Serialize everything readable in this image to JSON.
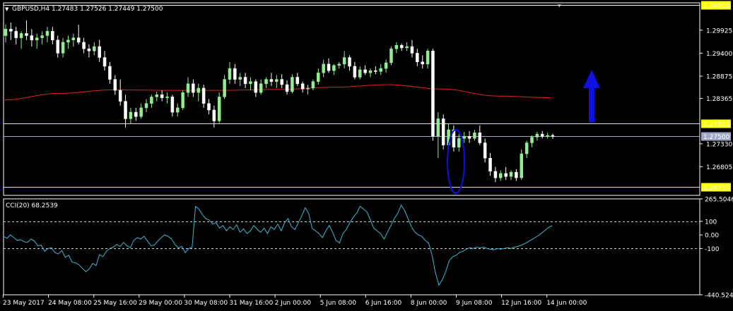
{
  "header": {
    "title": "GBPUSD,H4  1.27483 1.27526 1.27449 1.27500"
  },
  "indicator": {
    "label": "CCI(20) 68.2539"
  },
  "colors": {
    "background": "#000000",
    "frame": "#ffffff",
    "bull": "#90ee90",
    "bear": "#ffffff",
    "ma": "#e02020",
    "level": "#ffff00",
    "bid": "#a0a8c8",
    "cci": "#40b8d0",
    "annotation": "#1010e0"
  },
  "chart_data": [
    {
      "type": "candlestick",
      "symbol": "GBPUSD",
      "timeframe": "H4",
      "ylim": [
        1.2615,
        1.3055
      ],
      "y_ticks": [
        "1.30500",
        "1.29925",
        "1.29400",
        "1.28875",
        "1.28365",
        "1.27800",
        "1.27500",
        "1.27330",
        "1.26805",
        "1.26350"
      ],
      "x_ticks": [
        "23 May 2017",
        "24 May 08:00",
        "25 May 16:00",
        "29 May 00:00",
        "30 May 08:00",
        "31 May 16:00",
        "2 Jun 00:00",
        "5 Jun 08:00",
        "6 Jun 16:00",
        "8 Jun 00:00",
        "9 Jun 08:00",
        "12 Jun 16:00",
        "14 Jun 00:00"
      ],
      "levels": [
        {
          "value": 1.305,
          "label": "1.30500",
          "color": "#ffffff"
        },
        {
          "value": 1.278,
          "label": "1.27800",
          "color": "#ffff00"
        },
        {
          "value": 1.275,
          "label": "1.27500",
          "color": "#a0a8c8"
        },
        {
          "value": 1.2635,
          "label": "1.26350",
          "color": "#ffff00"
        }
      ],
      "ma_anchor": [
        1.2833,
        1.2848,
        1.2856,
        1.2855,
        1.2855,
        1.2857,
        1.2862,
        1.2868,
        1.2858,
        1.2842,
        1.2838
      ],
      "candles": [
        {
          "o": 1.298,
          "h": 1.3005,
          "l": 1.2965,
          "c": 1.2995
        },
        {
          "o": 1.2995,
          "h": 1.301,
          "l": 1.297,
          "c": 1.299
        },
        {
          "o": 1.299,
          "h": 1.3,
          "l": 1.296,
          "c": 1.2975
        },
        {
          "o": 1.2975,
          "h": 1.299,
          "l": 1.295,
          "c": 1.2985
        },
        {
          "o": 1.2985,
          "h": 1.3015,
          "l": 1.297,
          "c": 1.298
        },
        {
          "o": 1.298,
          "h": 1.2995,
          "l": 1.2955,
          "c": 1.297
        },
        {
          "o": 1.297,
          "h": 1.2985,
          "l": 1.295,
          "c": 1.2975
        },
        {
          "o": 1.2975,
          "h": 1.299,
          "l": 1.296,
          "c": 1.298
        },
        {
          "o": 1.298,
          "h": 1.3,
          "l": 1.2965,
          "c": 1.299
        },
        {
          "o": 1.299,
          "h": 1.3,
          "l": 1.296,
          "c": 1.297
        },
        {
          "o": 1.297,
          "h": 1.298,
          "l": 1.293,
          "c": 1.294
        },
        {
          "o": 1.294,
          "h": 1.2975,
          "l": 1.293,
          "c": 1.2965
        },
        {
          "o": 1.2965,
          "h": 1.298,
          "l": 1.295,
          "c": 1.297
        },
        {
          "o": 1.297,
          "h": 1.2985,
          "l": 1.2955,
          "c": 1.2975
        },
        {
          "o": 1.2975,
          "h": 1.3005,
          "l": 1.296,
          "c": 1.2965
        },
        {
          "o": 1.2965,
          "h": 1.2975,
          "l": 1.294,
          "c": 1.295
        },
        {
          "o": 1.295,
          "h": 1.296,
          "l": 1.293,
          "c": 1.2945
        },
        {
          "o": 1.2945,
          "h": 1.2965,
          "l": 1.2935,
          "c": 1.2955
        },
        {
          "o": 1.2955,
          "h": 1.297,
          "l": 1.292,
          "c": 1.293
        },
        {
          "o": 1.293,
          "h": 1.2945,
          "l": 1.29,
          "c": 1.291
        },
        {
          "o": 1.291,
          "h": 1.292,
          "l": 1.287,
          "c": 1.288
        },
        {
          "o": 1.288,
          "h": 1.289,
          "l": 1.2845,
          "c": 1.2855
        },
        {
          "o": 1.2855,
          "h": 1.288,
          "l": 1.282,
          "c": 1.283
        },
        {
          "o": 1.283,
          "h": 1.2845,
          "l": 1.277,
          "c": 1.279
        },
        {
          "o": 1.279,
          "h": 1.2815,
          "l": 1.2778,
          "c": 1.2805
        },
        {
          "o": 1.2805,
          "h": 1.2815,
          "l": 1.2785,
          "c": 1.2795
        },
        {
          "o": 1.2795,
          "h": 1.2825,
          "l": 1.279,
          "c": 1.2815
        },
        {
          "o": 1.2815,
          "h": 1.2835,
          "l": 1.2805,
          "c": 1.2825
        },
        {
          "o": 1.2825,
          "h": 1.2845,
          "l": 1.2815,
          "c": 1.284
        },
        {
          "o": 1.284,
          "h": 1.2852,
          "l": 1.283,
          "c": 1.2845
        },
        {
          "o": 1.2845,
          "h": 1.2855,
          "l": 1.283,
          "c": 1.2838
        },
        {
          "o": 1.2838,
          "h": 1.285,
          "l": 1.2825,
          "c": 1.284
        },
        {
          "o": 1.284,
          "h": 1.2845,
          "l": 1.2795,
          "c": 1.2805
        },
        {
          "o": 1.2805,
          "h": 1.2825,
          "l": 1.2795,
          "c": 1.2815
        },
        {
          "o": 1.2815,
          "h": 1.2855,
          "l": 1.281,
          "c": 1.285
        },
        {
          "o": 1.285,
          "h": 1.2885,
          "l": 1.284,
          "c": 1.287
        },
        {
          "o": 1.287,
          "h": 1.288,
          "l": 1.284,
          "c": 1.285
        },
        {
          "o": 1.285,
          "h": 1.287,
          "l": 1.283,
          "c": 1.286
        },
        {
          "o": 1.286,
          "h": 1.2868,
          "l": 1.2815,
          "c": 1.2825
        },
        {
          "o": 1.2825,
          "h": 1.2835,
          "l": 1.28,
          "c": 1.281
        },
        {
          "o": 1.281,
          "h": 1.282,
          "l": 1.277,
          "c": 1.2785
        },
        {
          "o": 1.2785,
          "h": 1.285,
          "l": 1.278,
          "c": 1.284
        },
        {
          "o": 1.284,
          "h": 1.289,
          "l": 1.2835,
          "c": 1.288
        },
        {
          "o": 1.288,
          "h": 1.292,
          "l": 1.287,
          "c": 1.2905
        },
        {
          "o": 1.2905,
          "h": 1.2915,
          "l": 1.287,
          "c": 1.288
        },
        {
          "o": 1.288,
          "h": 1.2895,
          "l": 1.2865,
          "c": 1.2885
        },
        {
          "o": 1.2885,
          "h": 1.2895,
          "l": 1.286,
          "c": 1.287
        },
        {
          "o": 1.287,
          "h": 1.2885,
          "l": 1.2855,
          "c": 1.2875
        },
        {
          "o": 1.2875,
          "h": 1.288,
          "l": 1.284,
          "c": 1.285
        },
        {
          "o": 1.285,
          "h": 1.288,
          "l": 1.2845,
          "c": 1.287
        },
        {
          "o": 1.287,
          "h": 1.2885,
          "l": 1.286,
          "c": 1.288
        },
        {
          "o": 1.288,
          "h": 1.2895,
          "l": 1.2865,
          "c": 1.2875
        },
        {
          "o": 1.2875,
          "h": 1.289,
          "l": 1.286,
          "c": 1.288
        },
        {
          "o": 1.288,
          "h": 1.2892,
          "l": 1.286,
          "c": 1.2868
        },
        {
          "o": 1.2868,
          "h": 1.2878,
          "l": 1.2845,
          "c": 1.2852
        },
        {
          "o": 1.2852,
          "h": 1.2892,
          "l": 1.2848,
          "c": 1.2885
        },
        {
          "o": 1.2885,
          "h": 1.2895,
          "l": 1.2865,
          "c": 1.287
        },
        {
          "o": 1.287,
          "h": 1.2875,
          "l": 1.285,
          "c": 1.2858
        },
        {
          "o": 1.2858,
          "h": 1.2868,
          "l": 1.2845,
          "c": 1.286
        },
        {
          "o": 1.286,
          "h": 1.288,
          "l": 1.2855,
          "c": 1.2875
        },
        {
          "o": 1.2875,
          "h": 1.2905,
          "l": 1.2868,
          "c": 1.2895
        },
        {
          "o": 1.2895,
          "h": 1.2925,
          "l": 1.2885,
          "c": 1.2915
        },
        {
          "o": 1.2915,
          "h": 1.2928,
          "l": 1.2895,
          "c": 1.29
        },
        {
          "o": 1.29,
          "h": 1.2915,
          "l": 1.289,
          "c": 1.2912
        },
        {
          "o": 1.2912,
          "h": 1.292,
          "l": 1.2905,
          "c": 1.2915
        },
        {
          "o": 1.2915,
          "h": 1.2945,
          "l": 1.2905,
          "c": 1.293
        },
        {
          "o": 1.293,
          "h": 1.2935,
          "l": 1.29,
          "c": 1.291
        },
        {
          "o": 1.291,
          "h": 1.292,
          "l": 1.288,
          "c": 1.2885
        },
        {
          "o": 1.2885,
          "h": 1.291,
          "l": 1.288,
          "c": 1.2902
        },
        {
          "o": 1.2902,
          "h": 1.2912,
          "l": 1.289,
          "c": 1.2895
        },
        {
          "o": 1.2895,
          "h": 1.2905,
          "l": 1.2885,
          "c": 1.29
        },
        {
          "o": 1.29,
          "h": 1.291,
          "l": 1.2892,
          "c": 1.2898
        },
        {
          "o": 1.2898,
          "h": 1.2915,
          "l": 1.289,
          "c": 1.2905
        },
        {
          "o": 1.2905,
          "h": 1.2925,
          "l": 1.2895,
          "c": 1.2918
        },
        {
          "o": 1.2918,
          "h": 1.2955,
          "l": 1.2912,
          "c": 1.295
        },
        {
          "o": 1.295,
          "h": 1.2965,
          "l": 1.294,
          "c": 1.2958
        },
        {
          "o": 1.2958,
          "h": 1.2962,
          "l": 1.2945,
          "c": 1.2952
        },
        {
          "o": 1.2952,
          "h": 1.2965,
          "l": 1.2945,
          "c": 1.2955
        },
        {
          "o": 1.2955,
          "h": 1.297,
          "l": 1.293,
          "c": 1.294
        },
        {
          "o": 1.294,
          "h": 1.295,
          "l": 1.291,
          "c": 1.292
        },
        {
          "o": 1.292,
          "h": 1.2935,
          "l": 1.2905,
          "c": 1.2915
        },
        {
          "o": 1.2915,
          "h": 1.295,
          "l": 1.2905,
          "c": 1.2945
        },
        {
          "o": 1.2945,
          "h": 1.295,
          "l": 1.274,
          "c": 1.275
        },
        {
          "o": 1.275,
          "h": 1.2805,
          "l": 1.27,
          "c": 1.279
        },
        {
          "o": 1.279,
          "h": 1.28,
          "l": 1.272,
          "c": 1.273
        },
        {
          "o": 1.273,
          "h": 1.278,
          "l": 1.272,
          "c": 1.2765
        },
        {
          "o": 1.2765,
          "h": 1.2775,
          "l": 1.2715,
          "c": 1.2725
        },
        {
          "o": 1.2725,
          "h": 1.2755,
          "l": 1.2715,
          "c": 1.2745
        },
        {
          "o": 1.2745,
          "h": 1.276,
          "l": 1.2735,
          "c": 1.275
        },
        {
          "o": 1.275,
          "h": 1.2762,
          "l": 1.2735,
          "c": 1.2745
        },
        {
          "o": 1.2745,
          "h": 1.2765,
          "l": 1.274,
          "c": 1.2758
        },
        {
          "o": 1.2758,
          "h": 1.2775,
          "l": 1.273,
          "c": 1.2735
        },
        {
          "o": 1.2735,
          "h": 1.2745,
          "l": 1.269,
          "c": 1.27
        },
        {
          "o": 1.27,
          "h": 1.2712,
          "l": 1.266,
          "c": 1.267
        },
        {
          "o": 1.267,
          "h": 1.268,
          "l": 1.2645,
          "c": 1.2655
        },
        {
          "o": 1.2655,
          "h": 1.2672,
          "l": 1.2648,
          "c": 1.2665
        },
        {
          "o": 1.2665,
          "h": 1.268,
          "l": 1.265,
          "c": 1.2658
        },
        {
          "o": 1.2658,
          "h": 1.2672,
          "l": 1.265,
          "c": 1.2668
        },
        {
          "o": 1.2668,
          "h": 1.2675,
          "l": 1.2648,
          "c": 1.2655
        },
        {
          "o": 1.2655,
          "h": 1.272,
          "l": 1.265,
          "c": 1.271
        },
        {
          "o": 1.271,
          "h": 1.274,
          "l": 1.27,
          "c": 1.2735
        },
        {
          "o": 1.2735,
          "h": 1.2752,
          "l": 1.2725,
          "c": 1.2748
        },
        {
          "o": 1.2748,
          "h": 1.276,
          "l": 1.274,
          "c": 1.2755
        },
        {
          "o": 1.2755,
          "h": 1.2762,
          "l": 1.2745,
          "c": 1.275
        },
        {
          "o": 1.275,
          "h": 1.2758,
          "l": 1.2745,
          "c": 1.2752
        },
        {
          "o": 1.2752,
          "h": 1.2756,
          "l": 1.2744,
          "c": 1.275
        }
      ]
    },
    {
      "type": "line",
      "name": "CCI(20) 68.2539",
      "ylim": [
        -440.5241,
        265.5046
      ],
      "y_ticks": [
        "265.5046",
        "100",
        "0.00",
        "-100",
        "-440.5241"
      ],
      "levels": [
        100,
        -100
      ],
      "values": [
        -10,
        -25,
        0,
        -20,
        -40,
        -35,
        -50,
        -55,
        -30,
        -45,
        -80,
        -75,
        -120,
        -100,
        -95,
        -130,
        -140,
        -115,
        -165,
        -150,
        -200,
        -205,
        -220,
        -245,
        -270,
        -250,
        -210,
        -225,
        -145,
        -160,
        -120,
        -100,
        -90,
        -70,
        -85,
        -55,
        -80,
        -95,
        -40,
        -20,
        -30,
        -10,
        -45,
        -80,
        -75,
        -45,
        -20,
        0,
        -10,
        -30,
        -70,
        -95,
        -85,
        -130,
        -100,
        -90,
        210,
        190,
        150,
        120,
        110,
        80,
        90,
        50,
        70,
        30,
        60,
        40,
        75,
        20,
        45,
        10,
        30,
        70,
        40,
        20,
        50,
        10,
        60,
        40,
        80,
        30,
        90,
        120,
        60,
        40,
        90,
        140,
        200,
        160,
        50,
        30,
        10,
        -20,
        30,
        70,
        20,
        -40,
        -60,
        10,
        40,
        90,
        130,
        160,
        210,
        190,
        170,
        110,
        50,
        30,
        10,
        -30,
        20,
        70,
        120,
        160,
        220,
        180,
        120,
        60,
        20,
        0,
        -10,
        -40,
        -60,
        -150,
        -280,
        -370,
        -330,
        -270,
        -190,
        -160,
        -150,
        -130,
        -120,
        -105,
        -95,
        -100,
        -90,
        -95,
        -90,
        -100,
        -105,
        -110,
        -100,
        -105,
        -100,
        -95,
        -100,
        -90,
        -85,
        -75,
        -65,
        -50,
        -35,
        -20,
        -5,
        15,
        35,
        55,
        68
      ]
    }
  ]
}
